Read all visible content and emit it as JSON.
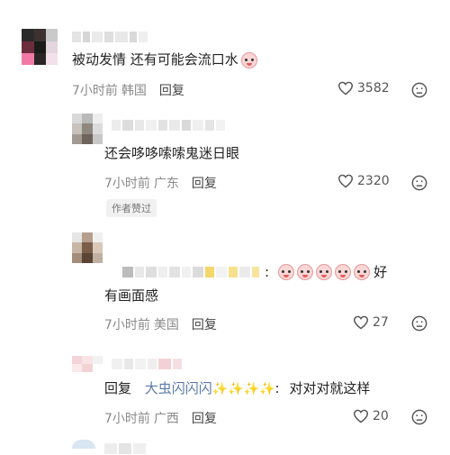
{
  "comments": [
    {
      "text": "被动发情 还有可能会流口水",
      "time": "7小时前",
      "location": "韩国",
      "reply_label": "回复",
      "likes": "3582"
    },
    {
      "text": "还会哆哆嗦嗦鬼迷日眼",
      "time": "7小时前",
      "location": "广东",
      "reply_label": "回复",
      "likes": "2320",
      "badge": "作者赞过"
    },
    {
      "text_suffix": "好",
      "text_line2": "有画面感",
      "time": "7小时前",
      "location": "美国",
      "reply_label": "回复",
      "likes": "27"
    },
    {
      "reply_prefix": "回复",
      "reply_to": "大虫闪闪闪",
      "text": "对对对就这样",
      "time": "7小时前",
      "location": "广西",
      "reply_label": "回复",
      "likes": "20"
    }
  ],
  "icons": {
    "like": "heart-outline-icon",
    "dislike": "frown-face-icon",
    "emoji": "crying-face-emoji",
    "sparkle": "sparkle-emoji"
  },
  "colors": {
    "text": "#222222",
    "meta": "#8a8a8a",
    "reply_to_name": "#5b7aa6"
  }
}
